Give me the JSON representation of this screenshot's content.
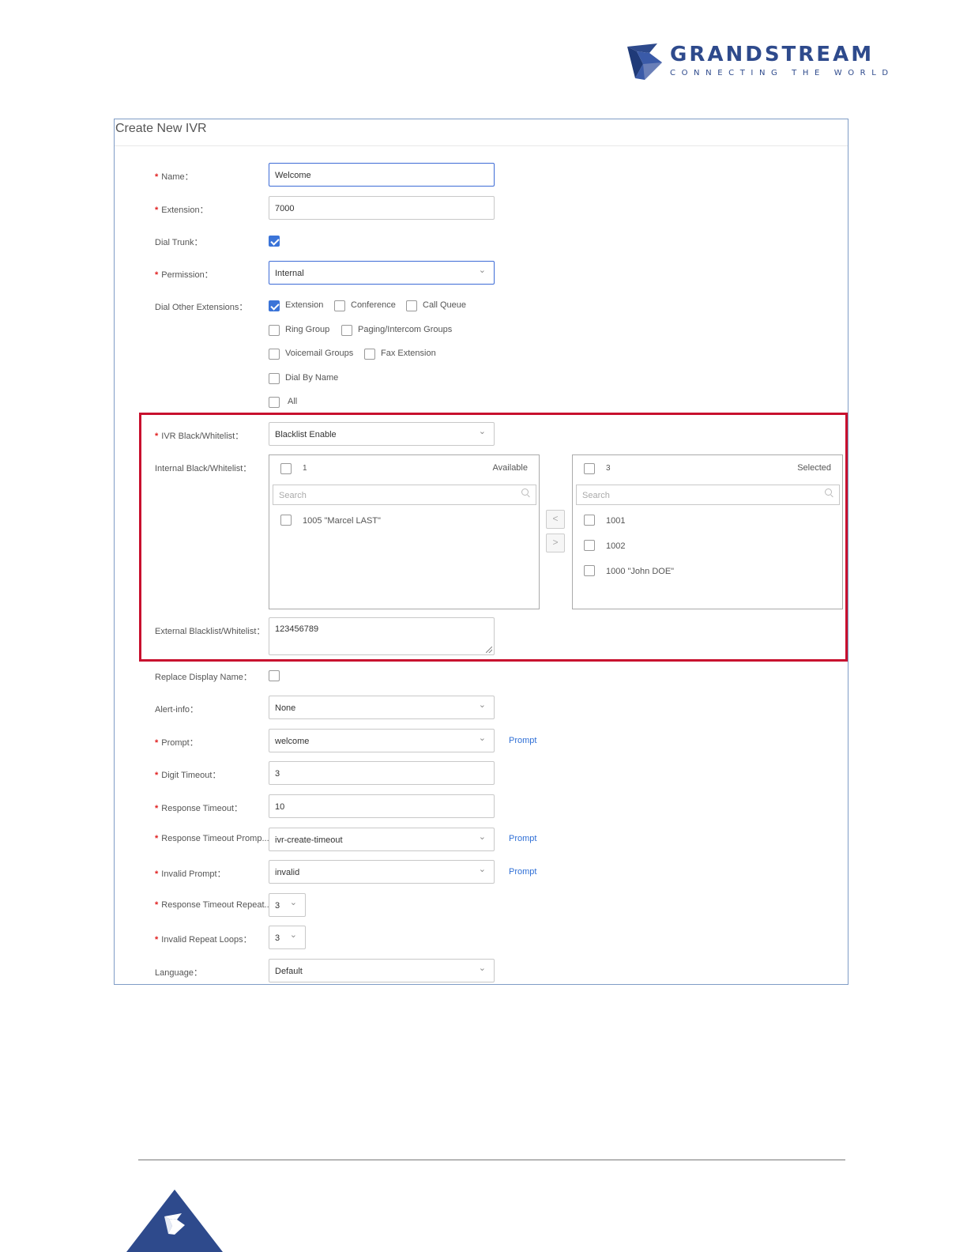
{
  "brand": {
    "name": "GRANDSTREAM",
    "tagline": "CONNECTING THE WORLD",
    "color": "#2e4a8c"
  },
  "panel": {
    "title": "Create New IVR"
  },
  "form": {
    "name": {
      "label": "Name：",
      "value": "Welcome"
    },
    "extension": {
      "label": "Extension：",
      "value": "7000"
    },
    "dial_trunk": {
      "label": "Dial Trunk：",
      "checked": true
    },
    "permission": {
      "label": "Permission：",
      "value": "Internal"
    },
    "dial_other_extensions": {
      "label": "Dial Other Extensions：",
      "options": [
        {
          "label": "Extension",
          "checked": true
        },
        {
          "label": "Conference",
          "checked": false
        },
        {
          "label": "Call Queue",
          "checked": false
        },
        {
          "label": "Ring Group",
          "checked": false
        },
        {
          "label": "Paging/Intercom Groups",
          "checked": false
        },
        {
          "label": "Voicemail Groups",
          "checked": false
        },
        {
          "label": "Fax Extension",
          "checked": false
        },
        {
          "label": "Dial By Name",
          "checked": false
        },
        {
          "label": "All",
          "checked": false
        }
      ]
    },
    "ivr_black_whitelist": {
      "label": "IVR Black/Whitelist：",
      "value": "Blacklist Enable"
    },
    "internal_black_whitelist": {
      "label": "Internal Black/Whitelist：",
      "available": {
        "count": "1",
        "title": "Available",
        "search_placeholder": "Search",
        "items": [
          "1005 \"Marcel LAST\""
        ]
      },
      "selected": {
        "count": "3",
        "title": "Selected",
        "search_placeholder": "Search",
        "items": [
          "1001",
          "1002",
          "1000 \"John DOE\""
        ]
      },
      "move_left": "<",
      "move_right": ">"
    },
    "external_blacklist_whitelist": {
      "label": "External Blacklist/Whitelist：",
      "value": "123456789"
    },
    "replace_display_name": {
      "label": "Replace Display Name：",
      "checked": false
    },
    "alert_info": {
      "label": "Alert-info：",
      "value": "None"
    },
    "prompt": {
      "label": "Prompt：",
      "value": "welcome",
      "link": "Prompt"
    },
    "digit_timeout": {
      "label": "Digit Timeout：",
      "value": "3"
    },
    "response_timeout": {
      "label": "Response Timeout：",
      "value": "10"
    },
    "response_timeout_prompt": {
      "label": "Response Timeout Promp...",
      "value": "ivr-create-timeout",
      "link": "Prompt"
    },
    "invalid_prompt": {
      "label": "Invalid Prompt：",
      "value": "invalid",
      "link": "Prompt"
    },
    "response_timeout_repeat": {
      "label": "Response Timeout Repeat...",
      "value": "3"
    },
    "invalid_repeat_loops": {
      "label": "Invalid Repeat Loops：",
      "value": "3"
    },
    "language": {
      "label": "Language：",
      "value": "Default"
    }
  },
  "colors": {
    "accent": "#3b74d8",
    "link": "#2f6fd6",
    "highlight": "#c8102e",
    "required": "#e02020"
  }
}
